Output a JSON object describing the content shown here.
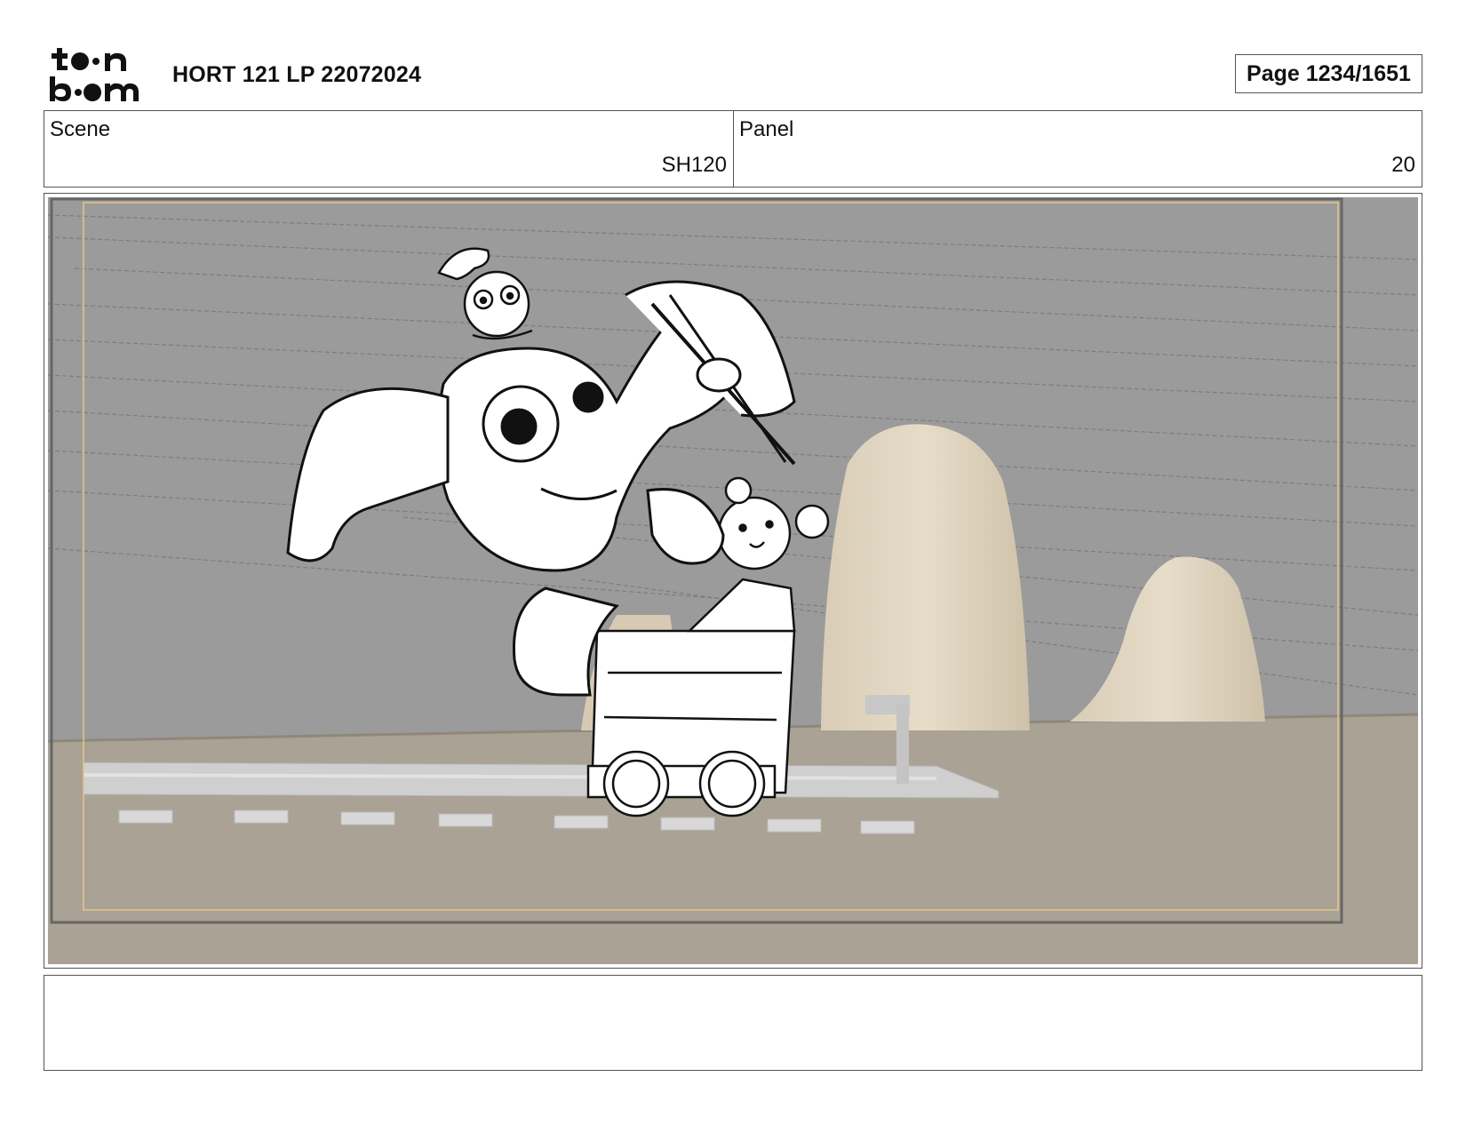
{
  "header": {
    "logo_text": "toon boom",
    "project_title": "HORT 121 LP 22072024",
    "page_label": "Page 1234/1651"
  },
  "info": {
    "scene_label": "Scene",
    "scene_value": "SH120",
    "panel_label": "Panel",
    "panel_value": "20"
  },
  "notes": {
    "text": ""
  }
}
